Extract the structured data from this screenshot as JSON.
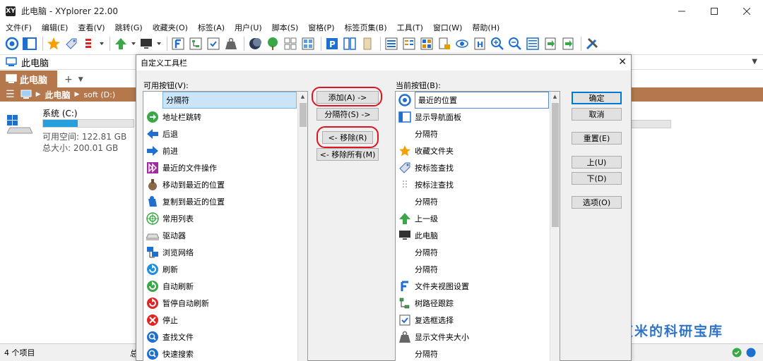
{
  "window": {
    "title": "此电脑 - XYplorer 22.00",
    "app_icon": "XY",
    "controls": [
      "minimize",
      "maximize",
      "close"
    ]
  },
  "menu": [
    "文件(F)",
    "编辑(E)",
    "查看(V)",
    "跳转(G)",
    "收藏夹(O)",
    "标签(A)",
    "用户(U)",
    "脚本(S)",
    "窗格(P)",
    "标签页集(B)",
    "工具(T)",
    "窗口(W)",
    "帮助(H)"
  ],
  "address": {
    "text": "此电脑"
  },
  "tabs": {
    "active": "此电脑",
    "plus": "+",
    "arrow": "▼"
  },
  "breadcrumb": {
    "menu_icon": "☰",
    "root": "此电脑",
    "next": "soft (D:)"
  },
  "drive": {
    "name": "系统 (C:)",
    "free": "可用空间: 122.81 GB",
    "total": "总大小: 200.01 GB",
    "used_fraction": 0.386
  },
  "status": {
    "items": "4 个项目",
    "truncated": "总"
  },
  "watermark": "艾米的科研宝库",
  "dialog": {
    "title": "自定义工具栏",
    "close": "✕",
    "available_label": "可用按钮(V):",
    "current_label": "当前按钮(B):",
    "available_items": [
      {
        "icon": "none",
        "label": "分隔符",
        "selected": true
      },
      {
        "icon": "goto-icon",
        "label": "地址栏跳转"
      },
      {
        "icon": "back-icon",
        "label": "后退"
      },
      {
        "icon": "forward-icon",
        "label": "前进"
      },
      {
        "icon": "recent-ops-icon",
        "label": "最近的文件操作"
      },
      {
        "icon": "move-recent-icon",
        "label": "移动到最近的位置"
      },
      {
        "icon": "copy-recent-icon",
        "label": "复制到最近的位置"
      },
      {
        "icon": "common-list-icon",
        "label": "常用列表"
      },
      {
        "icon": "drive-icon",
        "label": "驱动器"
      },
      {
        "icon": "network-icon",
        "label": "浏览网络"
      },
      {
        "icon": "refresh-icon",
        "label": "刷新"
      },
      {
        "icon": "auto-refresh-icon",
        "label": "自动刷新"
      },
      {
        "icon": "pause-refresh-icon",
        "label": "暂停自动刷新"
      },
      {
        "icon": "stop-icon",
        "label": "停止"
      },
      {
        "icon": "find-icon",
        "label": "查找文件"
      },
      {
        "icon": "quick-search-icon",
        "label": "快速搜索"
      }
    ],
    "current_items": [
      {
        "icon": "recent-location-icon",
        "label": "最近的位置",
        "focused": true
      },
      {
        "icon": "nav-panel-icon",
        "label": "显示导航面板"
      },
      {
        "icon": "none",
        "label": "分隔符"
      },
      {
        "icon": "star-icon",
        "label": "收藏文件夹"
      },
      {
        "icon": "tag-icon",
        "label": "按标签查找"
      },
      {
        "icon": "comment-icon",
        "label": "按标注查找"
      },
      {
        "icon": "none",
        "label": "分隔符"
      },
      {
        "icon": "up-icon",
        "label": "上一级"
      },
      {
        "icon": "computer-icon",
        "label": "此电脑"
      },
      {
        "icon": "none",
        "label": "分隔符"
      },
      {
        "icon": "none",
        "label": "分隔符"
      },
      {
        "icon": "folder-view-icon",
        "label": "文件夹视图设置"
      },
      {
        "icon": "tree-path-icon",
        "label": "树路径跟踪"
      },
      {
        "icon": "checkbox-icon",
        "label": "复选框选择"
      },
      {
        "icon": "folder-size-icon",
        "label": "显示文件夹大小"
      },
      {
        "icon": "none",
        "label": "分隔符"
      }
    ],
    "buttons": {
      "add": "添加(A) ->",
      "separator": "分隔符(S) ->",
      "remove": "<- 移除(R)",
      "remove_all": "<- 移除所有(M)",
      "ok": "确定",
      "cancel": "取消",
      "reset": "重置(E)",
      "up": "上(U)",
      "down": "下(D)",
      "options": "选项(O)"
    },
    "highlight_color": "#e0141e"
  },
  "colors": {
    "tab_brown": "#b5784d",
    "drive_bar": "#26a0da",
    "watermark": "#2f74c8",
    "selection": "#cce4f7"
  }
}
